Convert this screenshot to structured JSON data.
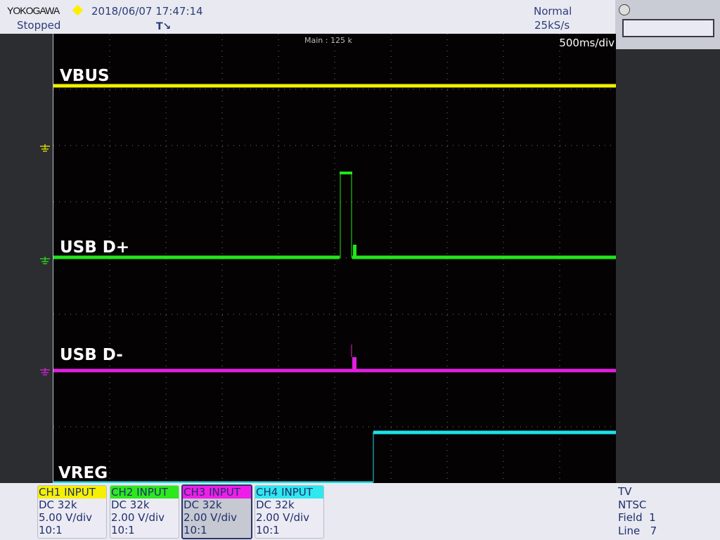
{
  "header": {
    "brand": "YOKOGAWA",
    "datetime": "2018/06/07 17:47:14",
    "status": "Stopped",
    "trigger_mode": "Normal",
    "sample_rate": "25kS/s",
    "timebase": "500ms/div",
    "record_length": "Main : 125 k",
    "status_led_color": "#ffee00"
  },
  "traces": [
    {
      "label": "VBUS",
      "color": "#f0f000"
    },
    {
      "label": "USB D+",
      "color": "#22e41a"
    },
    {
      "label": "USB D-",
      "color": "#e21ee0"
    },
    {
      "label": "VREG",
      "color": "#1de0e8"
    }
  ],
  "channels": [
    {
      "title": "CH1 INPUT",
      "coupling": "DC 32k",
      "scale": "5.00 V/div",
      "probe": "10:1",
      "color": "#f6f000"
    },
    {
      "title": "CH2 INPUT",
      "coupling": "DC 32k",
      "scale": "2.00 V/div",
      "probe": "10:1",
      "color": "#2ee81e"
    },
    {
      "title": "CH3 INPUT",
      "coupling": "DC 32k",
      "scale": "2.00 V/div",
      "probe": "10:1",
      "color": "#ee1ee8",
      "selected": true
    },
    {
      "title": "CH4 INPUT",
      "coupling": "DC 32k",
      "scale": "2.00 V/div",
      "probe": "10:1",
      "color": "#2ee8f0"
    }
  ],
  "display_mode": {
    "type": "TV",
    "standard": "NTSC",
    "field": "Field  1",
    "line": "Line   7"
  }
}
